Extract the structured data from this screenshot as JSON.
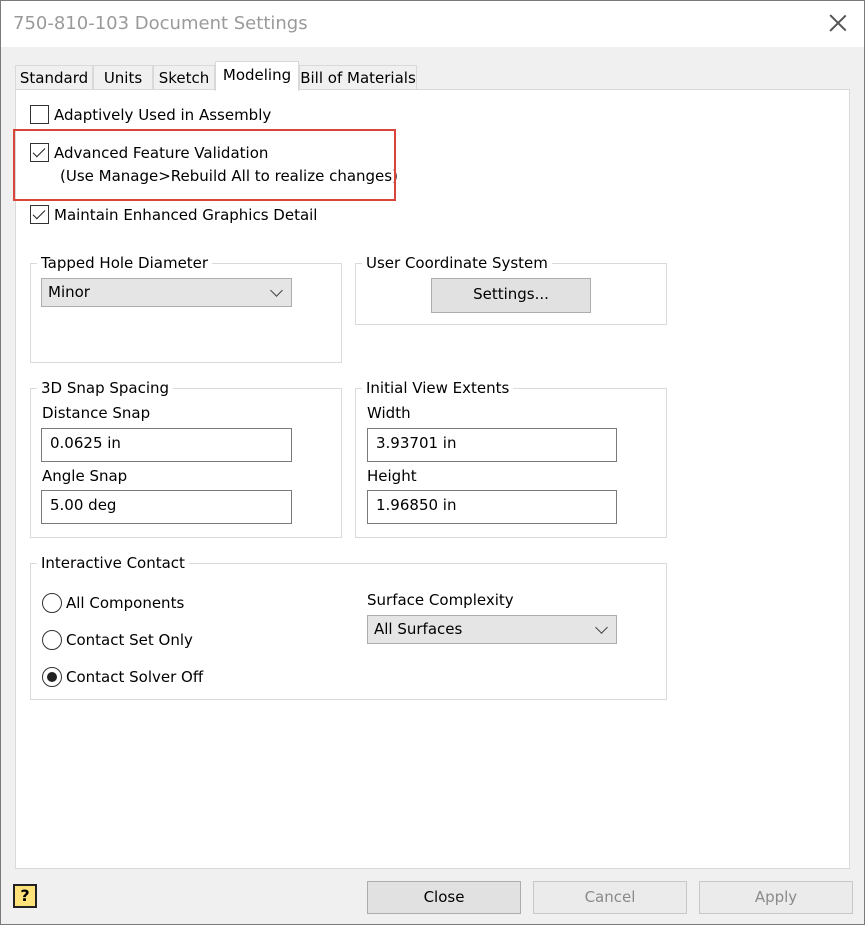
{
  "window": {
    "title": "750-810-103 Document Settings"
  },
  "tabs": [
    {
      "label": "Standard"
    },
    {
      "label": "Units"
    },
    {
      "label": "Sketch"
    },
    {
      "label": "Modeling",
      "active": true
    },
    {
      "label": "Bill of Materials"
    }
  ],
  "options": {
    "adaptive": {
      "label": "Adaptively Used in Assembly",
      "checked": false
    },
    "advanced_validation": {
      "label": "Advanced Feature Validation",
      "note": "(Use Manage>Rebuild All to realize changes)",
      "checked": true
    },
    "enhanced_graphics": {
      "label": "Maintain Enhanced Graphics Detail",
      "checked": true
    }
  },
  "tapped_hole": {
    "title": "Tapped Hole Diameter",
    "value": "Minor"
  },
  "ucs": {
    "title": "User Coordinate System",
    "button": "Settings..."
  },
  "snap": {
    "title": "3D Snap Spacing",
    "distance_label": "Distance Snap",
    "distance_value": "0.0625 in",
    "angle_label": "Angle Snap",
    "angle_value": "5.00 deg"
  },
  "view_extents": {
    "title": "Initial View Extents",
    "width_label": "Width",
    "width_value": "3.93701 in",
    "height_label": "Height",
    "height_value": "1.96850 in"
  },
  "contact": {
    "title": "Interactive Contact",
    "radios": [
      {
        "label": "All Components",
        "selected": false
      },
      {
        "label": "Contact Set Only",
        "selected": false
      },
      {
        "label": "Contact Solver Off",
        "selected": true
      }
    ],
    "surface_label": "Surface Complexity",
    "surface_value": "All Surfaces"
  },
  "footer": {
    "help_glyph": "?",
    "close": "Close",
    "cancel": "Cancel",
    "apply": "Apply"
  },
  "colors": {
    "highlight": "#d9453b",
    "panel": "#f0f0f0"
  }
}
